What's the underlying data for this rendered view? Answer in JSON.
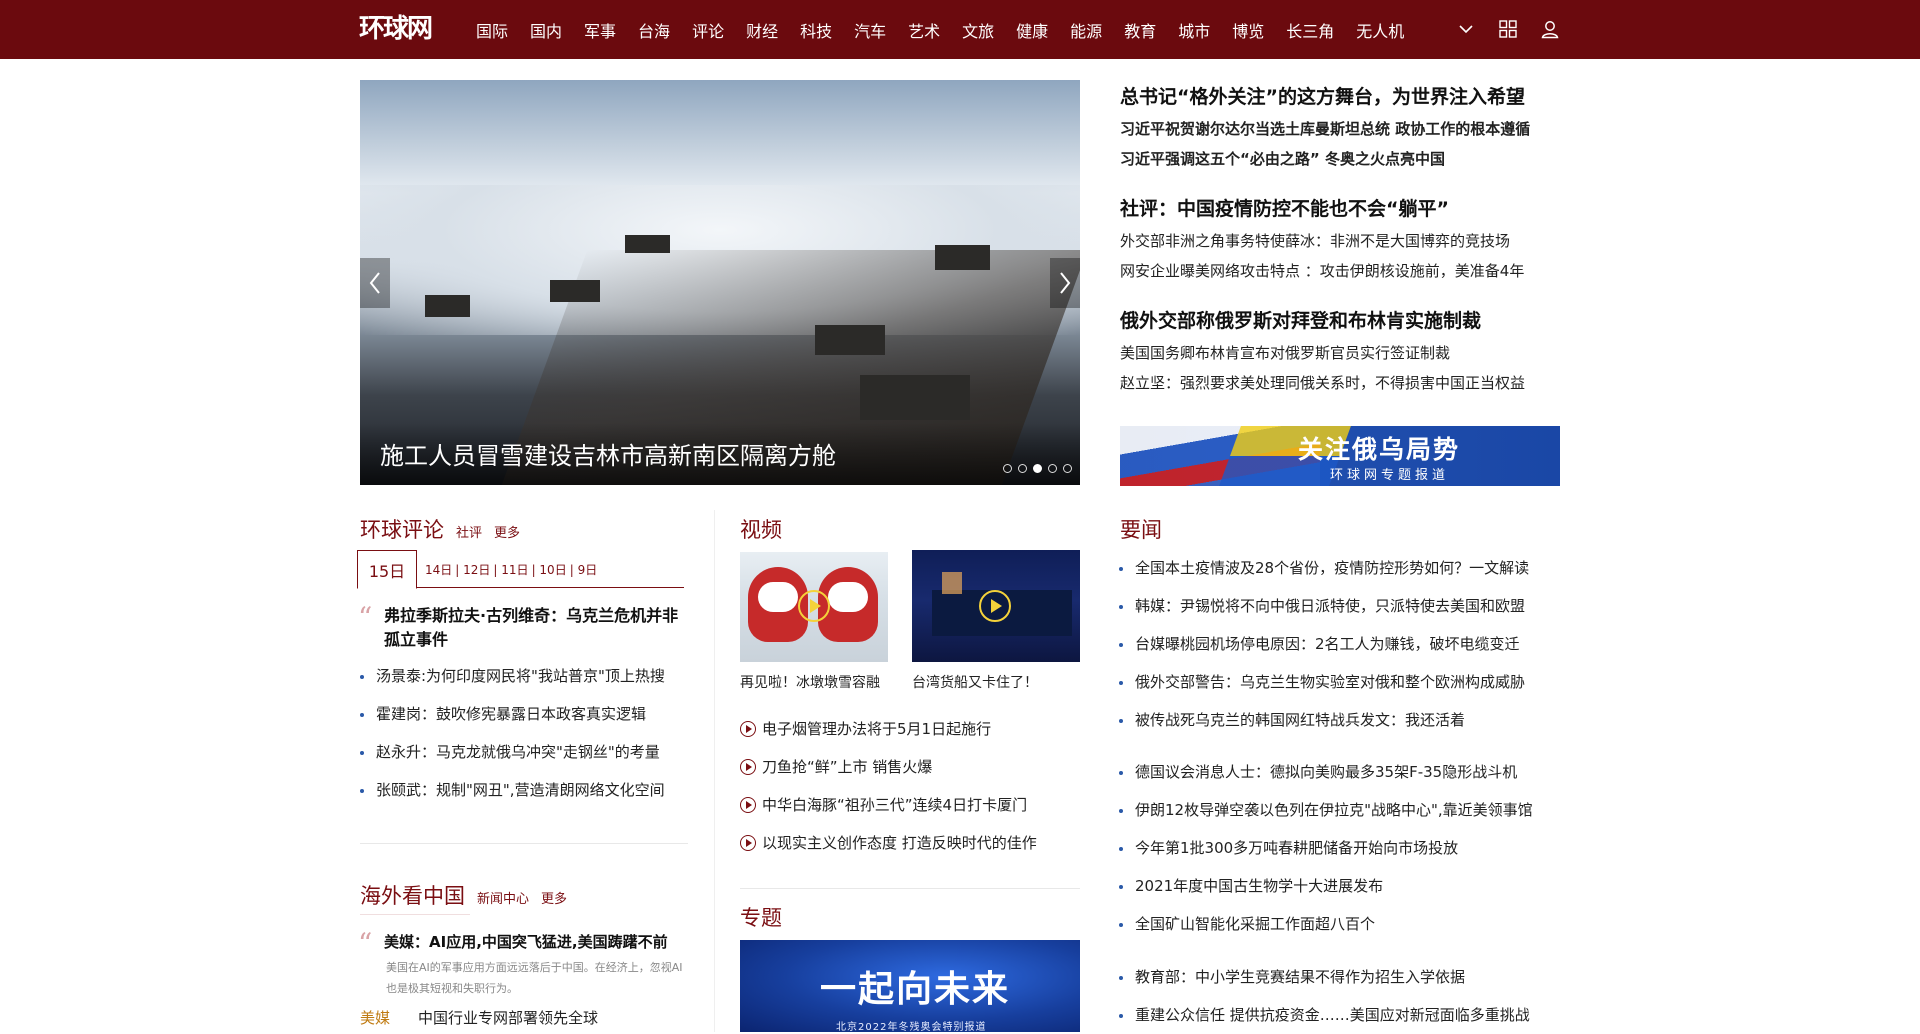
{
  "nav": {
    "logo": "环球网",
    "items": [
      "国际",
      "国内",
      "军事",
      "台海",
      "评论",
      "财经",
      "科技",
      "汽车",
      "艺术",
      "文旅",
      "健康",
      "能源",
      "教育",
      "城市",
      "博览",
      "长三角",
      "无人机"
    ]
  },
  "hero": {
    "caption": "施工人员冒雪建设吉林市高新南区隔离方舱",
    "slide_count": 5,
    "active_slide": 3
  },
  "headlines": [
    {
      "title": "总书记“格外关注”的这方舞台，为世界注入希望",
      "subs": [
        "习近平祝贺谢尔达尔当选土库曼斯坦总统 政协工作的根本遵循",
        "习近平强调这五个“必由之路” 冬奥之火点亮中国"
      ],
      "subs_bold": true
    },
    {
      "title": "社评：中国疫情防控不能也不会“躺平”",
      "subs": [
        "外交部非洲之角事务特使薛冰：非洲不是大国博弈的竞技场",
        "网安企业曝美网络攻击特点 ：攻击伊朗核设施前，美准备4年"
      ],
      "subs_bold": false
    },
    {
      "title": "俄外交部称俄罗斯对拜登和布林肯实施制裁",
      "subs": [
        "美国国务卿布林肯宣布对俄罗斯官员实行签证制裁",
        "赵立坚：强烈要求美处理同俄关系时，不得损害中国正当权益"
      ],
      "subs_bold": false
    }
  ],
  "banner": {
    "title": "关注俄乌局势",
    "subtitle": "环球网专题报道"
  },
  "commentary": {
    "title": "环球评论",
    "links": [
      "社评",
      "更多"
    ],
    "tab_active": "15日",
    "tabs_rest": [
      "14日",
      "12日",
      "11日",
      "10日",
      "9日"
    ],
    "quote": "弗拉季斯拉夫·古列维奇：乌克兰危机并非孤立事件",
    "items": [
      "汤景泰:为何印度网民将\"我站普京\"顶上热搜",
      "霍建岗：鼓吹修宪暴露日本政客真实逻辑",
      "赵永升：马克龙就俄乌冲突\"走钢丝\"的考量",
      "张颐武：规制\"网丑\",营造清朗网络文化空间"
    ]
  },
  "overseas": {
    "title": "海外看中国",
    "links": [
      "新闻中心",
      "更多"
    ],
    "quote": "美媒：AI应用,中国突飞猛进,美国踌躇不前",
    "summary": "美国在AI的军事应用方面远远落后于中国。在经济上，忽视AI也是极其短视和失职行为。",
    "tag": "美媒",
    "tag_text": "中国行业专网部署领先全球"
  },
  "video": {
    "title": "视频",
    "clips": [
      {
        "caption": "再见啦！冰墩墩雪容融"
      },
      {
        "caption": "台湾货船又卡住了！"
      }
    ],
    "items": [
      "电子烟管理办法将于5月1日起施行",
      "刀鱼抢“鲜”上市 销售火爆",
      "中华白海豚“祖孙三代”连续4日打卡厦门",
      "以现实主义创作态度 打造反映时代的佳作"
    ]
  },
  "special": {
    "title": "专题",
    "banner_text": "一起向未来",
    "banner_sub": "北京2022年冬残奥会特别报道"
  },
  "news": {
    "title": "要闻",
    "group1": [
      "全国本土疫情波及28个省份，疫情防控形势如何？一文解读",
      "韩媒：尹锡悦将不向中俄日派特使，只派特使去美国和欧盟",
      "台媒曝桃园机场停电原因：2名工人为赚钱，破坏电缆变迁",
      "俄外交部警告：乌克兰生物实验室对俄和整个欧洲构成威胁",
      "被传战死乌克兰的韩国网红特战兵发文：我还活着"
    ],
    "group2": [
      "德国议会消息人士：德拟向美购最多35架F-35隐形战斗机",
      "伊朗12枚导弹空袭以色列在伊拉克\"战略中心\",靠近美领事馆",
      "今年第1批300多万吨春耕肥储备开始向市场投放",
      "2021年度中国古生物学十大进展发布",
      "全国矿山智能化采掘工作面超八百个"
    ],
    "group3": [
      "教育部：中小学生竞赛结果不得作为招生入学依据",
      "重建公众信任 提供抗疫资金……美国应对新冠面临多重挑战"
    ]
  },
  "colors": {
    "brand": "#6b0a0e",
    "accent_text": "#7a0e12",
    "bullet": "#2a59a8",
    "tag": "#c07b12"
  }
}
